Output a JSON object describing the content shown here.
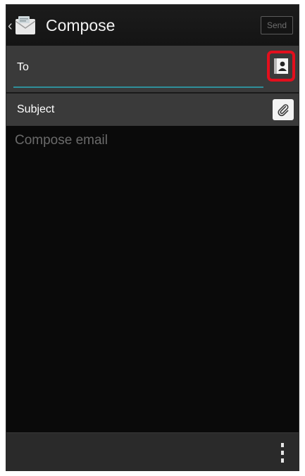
{
  "action_bar": {
    "back_glyph": "‹",
    "app_icon": "email-app-icon",
    "title": "Compose",
    "send_label": "Send"
  },
  "to_row": {
    "label": "To",
    "contacts_icon": "contacts-icon",
    "highlight_color": "#e30f1d"
  },
  "subject_row": {
    "label": "Subject",
    "attach_icon": "paperclip-icon"
  },
  "body": {
    "placeholder": "Compose email"
  },
  "bottom_bar": {
    "menu_icon": "overflow-menu-icon"
  },
  "colors": {
    "accent": "#2f8f9a",
    "background": "#0a0a0a",
    "field_background": "#3a3a3a"
  }
}
